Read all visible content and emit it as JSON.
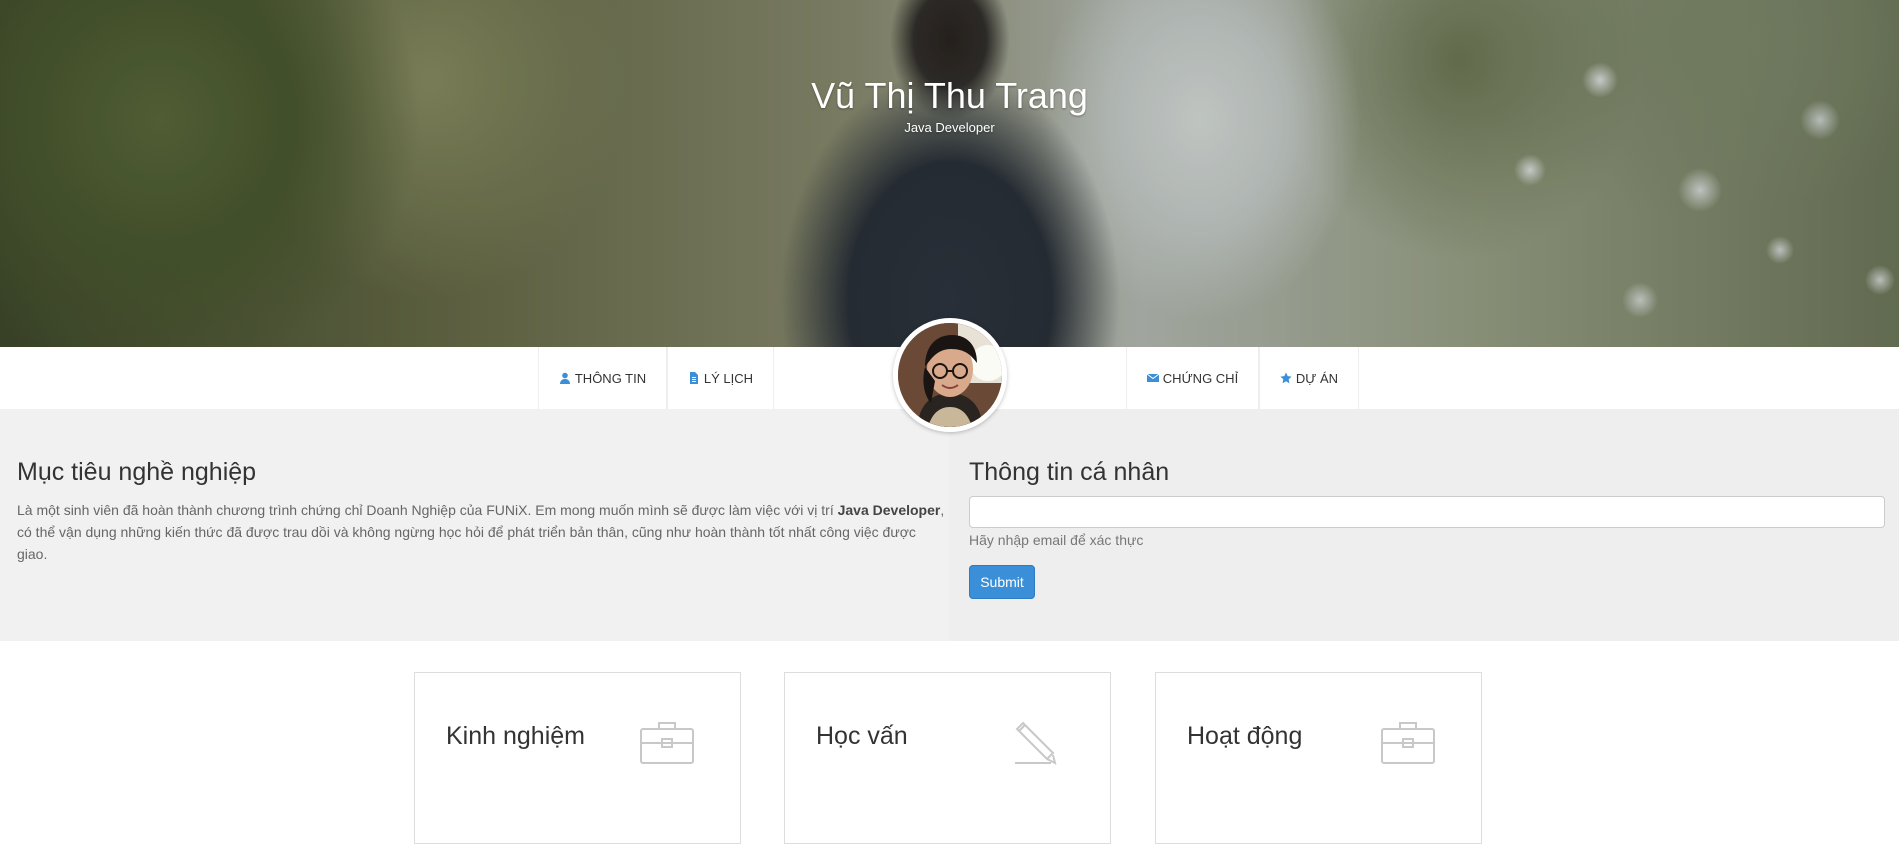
{
  "hero": {
    "name": "Vũ Thị Thu Trang",
    "role": "Java Developer"
  },
  "nav": {
    "items": [
      {
        "label": "THÔNG TIN",
        "icon": "user-icon"
      },
      {
        "label": "LÝ LỊCH",
        "icon": "file-icon"
      },
      {
        "label": "CHỨNG CHỈ",
        "icon": "envelope-icon"
      },
      {
        "label": "DỰ ÁN",
        "icon": "star-icon"
      }
    ],
    "avatar_icon": "profile-photo"
  },
  "objective": {
    "title": "Mục tiêu nghề nghiệp",
    "text_before": "Là một sinh viên đã hoàn thành chương trình chứng chỉ Doanh Nghiệp của FUNiX. Em mong muốn mình sẽ được làm việc với vị trí ",
    "text_bold": "Java Developer",
    "text_after": ", có thể vận dụng những kiến thức đã được trau dồi và không ngừng học hỏi để phát triển bản thân, cũng như hoàn thành tốt nhất công việc được giao."
  },
  "personal_info": {
    "title": "Thông tin cá nhân",
    "email_value": "",
    "email_help": "Hãy nhập email để xác thực",
    "submit_label": "Submit"
  },
  "cards": [
    {
      "title": "Kinh nghiệm",
      "icon": "briefcase-icon"
    },
    {
      "title": "Học vấn",
      "icon": "pencil-icon"
    },
    {
      "title": "Hoạt động",
      "icon": "briefcase-icon"
    }
  ],
  "colors": {
    "accent": "#3a8fd8",
    "middle_bg": "#f0f0f0",
    "text": "#333333"
  }
}
